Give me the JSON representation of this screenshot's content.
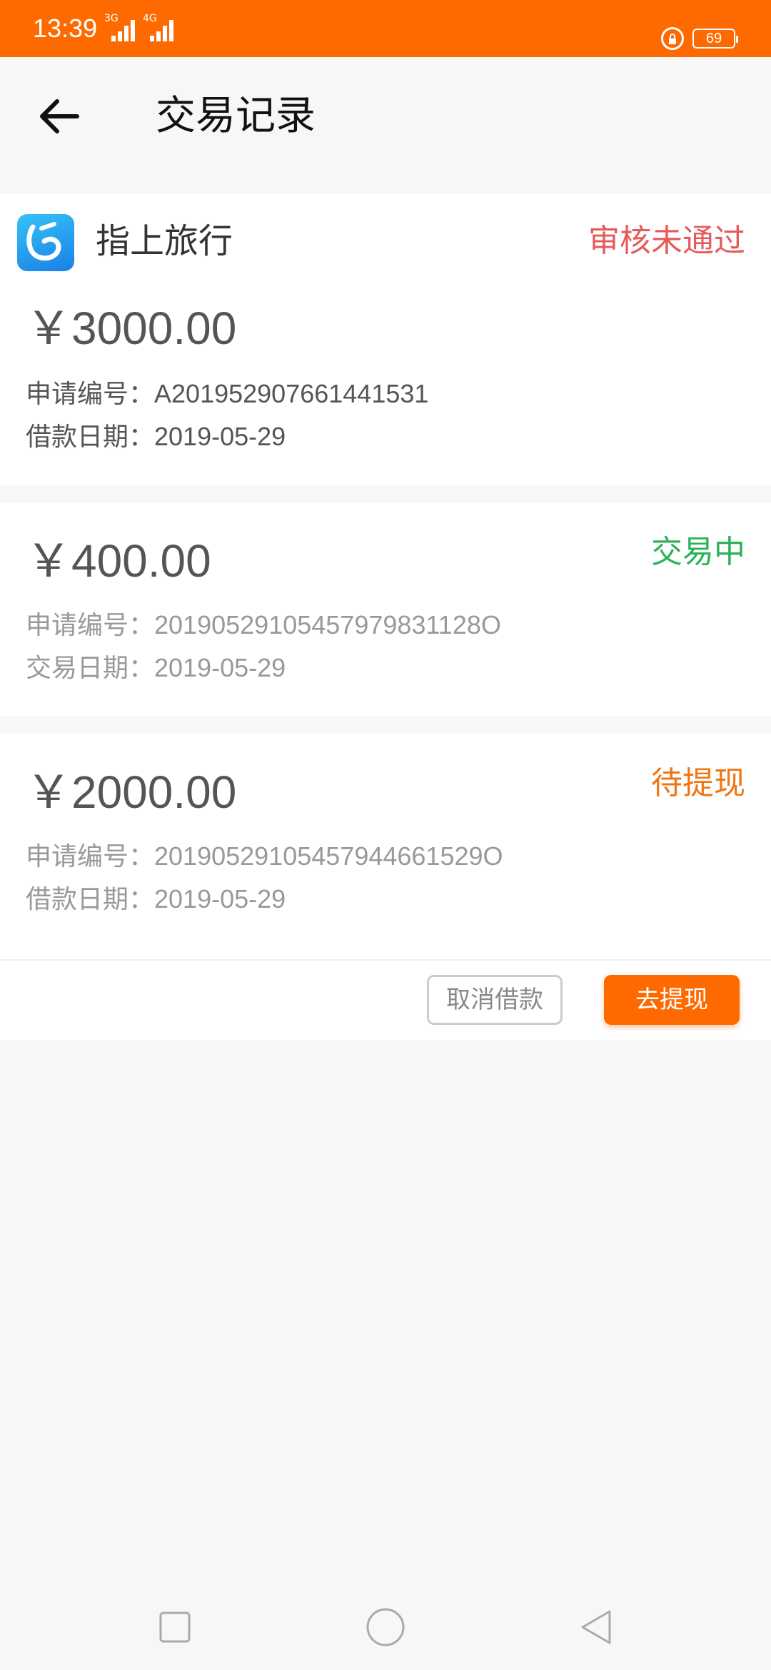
{
  "status_bar": {
    "time": "13:39",
    "signal1": "3G",
    "signal2": "4G",
    "battery": "69"
  },
  "header": {
    "title": "交易记录"
  },
  "records": [
    {
      "merchant": "指上旅行",
      "status": "审核未通过",
      "status_color": "#e85a5a",
      "amount": "￥3000.00",
      "id_label": "申请编号：",
      "id_value": "A201952907661441531",
      "date_label": "借款日期：",
      "date_value": "2019-05-29"
    },
    {
      "status": "交易中",
      "status_color": "#2bb256",
      "amount": "￥400.00",
      "id_label": "申请编号：",
      "id_value": "20190529105457979831128O",
      "date_label": "交易日期：",
      "date_value": "2019-05-29"
    },
    {
      "status": "待提现",
      "status_color": "#f07613",
      "amount": "￥2000.00",
      "id_label": "申请编号：",
      "id_value": "20190529105457944661529O",
      "date_label": "借款日期：",
      "date_value": "2019-05-29",
      "cancel_label": "取消借款",
      "withdraw_label": "去提现"
    }
  ],
  "colors": {
    "accent": "#ff6a00",
    "background": "#f7f7f7"
  },
  "icons": {
    "back": "arrow-left-icon",
    "nav_recent": "square-icon",
    "nav_home": "circle-icon",
    "nav_back": "triangle-back-icon"
  }
}
